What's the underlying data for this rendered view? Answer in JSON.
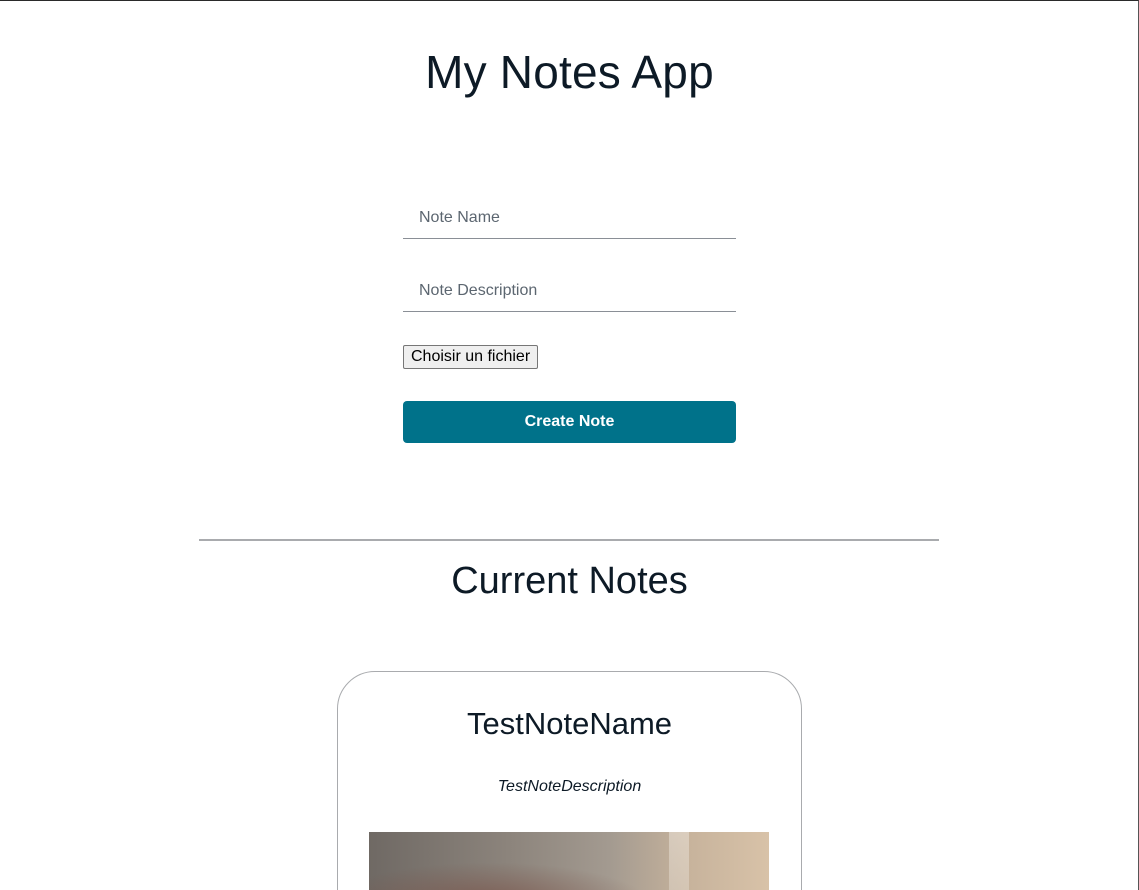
{
  "header": {
    "title": "My Notes App"
  },
  "form": {
    "name_placeholder": "Note Name",
    "description_placeholder": "Note Description",
    "file_button_label": "Choisir un fichier",
    "create_button_label": "Create Note"
  },
  "notes_section": {
    "title": "Current Notes",
    "notes": [
      {
        "name": "TestNoteName",
        "description": "TestNoteDescription"
      }
    ]
  },
  "colors": {
    "accent": "#00728a",
    "text": "#0d1a26"
  }
}
